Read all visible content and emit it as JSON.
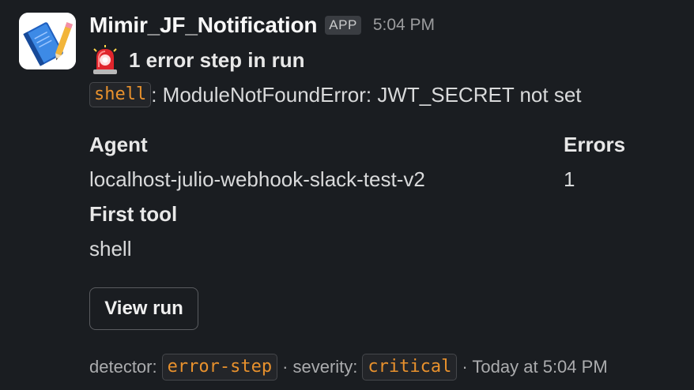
{
  "message": {
    "app_name": "Mimir_JF_Notification",
    "app_badge": "APP",
    "timestamp": "5:04 PM",
    "avatar_icon": "notebook-pencil-icon",
    "title_icon": "rotating-light-icon",
    "title": "1 error step in run",
    "error": {
      "tool_chip": "shell",
      "text": ": ModuleNotFoundError: JWT_SECRET not set"
    },
    "fields": {
      "agent_label": "Agent",
      "agent_value": "localhost-julio-webhook-slack-test-v2",
      "errors_label": "Errors",
      "errors_value": "1",
      "first_tool_label": "First tool",
      "first_tool_value": "shell"
    },
    "button_label": "View run",
    "context": {
      "detector_prefix": "detector:",
      "detector_value": "error-step",
      "severity_prefix": "· severity:",
      "severity_value": "critical",
      "time_text": "· Today at 5:04 PM"
    },
    "colors": {
      "background": "#1a1d21",
      "code_chip_text": "#e8912d",
      "siren_red": "#e0252c"
    }
  }
}
